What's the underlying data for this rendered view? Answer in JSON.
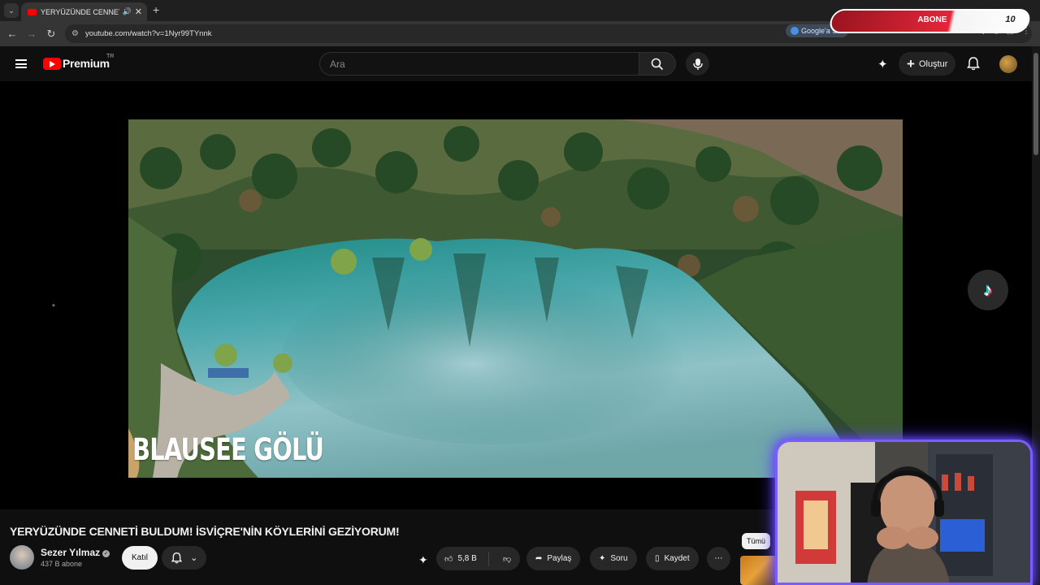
{
  "browser": {
    "tab_title": "YERYÜZÜNDE CENNETİ BULDUM",
    "tab_menu_icon": "chevron-down-icon",
    "url": "youtube.com/watch?v=1Nyr99TYnnk",
    "google_chip": "Google'a Sor"
  },
  "overlay": {
    "subscribe_label": "ABONE",
    "subscribe_count": "10"
  },
  "youtube": {
    "brand": "Premium",
    "region": "TR",
    "search_placeholder": "Ara",
    "create_label": "Oluştur"
  },
  "video": {
    "caption": "BLAUSEE GÖLÜ",
    "title": "YERYÜZÜNDE CENNETİ BULDUM! İSVİÇRE'NİN KÖYLERİNİ GEZİYORUM!",
    "channel": "Sezer Yılmaz",
    "subscribers": "437 B abone",
    "join_label": "Katıl",
    "likes": "5,8 B",
    "share_label": "Paylaş",
    "ask_label": "Soru",
    "save_label": "Kaydet"
  },
  "sidebar": {
    "filter_chip": "Tümü"
  },
  "colors": {
    "accent": "#ff0000",
    "background": "#0f0f0f",
    "facecam_glow": "#7b5cff"
  }
}
